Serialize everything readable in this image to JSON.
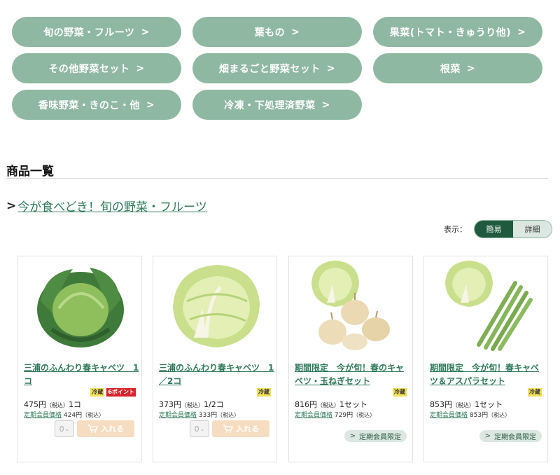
{
  "categories": [
    {
      "label": "旬の野菜・フルーツ"
    },
    {
      "label": "葉もの"
    },
    {
      "label": "果菜(トマト・きゅうり他)"
    },
    {
      "label": "その他野菜セット"
    },
    {
      "label": "畑まるごと野菜セット"
    },
    {
      "label": "根菜"
    },
    {
      "label": "香味野菜・きのこ・他"
    },
    {
      "label": "冷凍・下処理済野菜"
    }
  ],
  "chevron": ">",
  "section_title": "商品一覧",
  "breadcrumb": {
    "arrow": ">",
    "label": "今が食べどき！旬の野菜・フルーツ"
  },
  "view": {
    "label": "表示：",
    "simple": "簡易",
    "detail": "詳細",
    "active": "簡易"
  },
  "tax_label": "（税込）",
  "member_price_label": "定期会員価格",
  "colors": {
    "accent": "#8fb8a3",
    "dark": "#1f5a3e",
    "link": "#2f7a5a",
    "cart": "#f6dcc0",
    "badge_cold": "#f2e05a",
    "badge_point": "#d8232a"
  },
  "products": [
    {
      "name": "三浦のふんわり春キャベツ　1コ",
      "cold": "冷蔵",
      "point": "6ポイント",
      "price": "475円",
      "unit": "1コ",
      "member_price": "424円",
      "qty": "0",
      "cart": "入れる",
      "image": "cabbage-whole"
    },
    {
      "name": "三浦のふんわり春キャベツ　1／2コ",
      "cold": "冷蔵",
      "price": "373円",
      "unit": "1/2コ",
      "member_price": "333円",
      "qty": "0",
      "cart": "入れる",
      "image": "cabbage-half"
    },
    {
      "name": "期間限定　今が旬！春のキャベツ・玉ねぎセット",
      "cold": "冷蔵",
      "price": "816円",
      "unit": "1セット",
      "member_price": "729円",
      "member_only": "定期会員限定",
      "image": "cabbage-onion-set"
    },
    {
      "name": "期間限定　今が旬！春キャベツ＆アスパラセット",
      "cold": "冷蔵",
      "price": "853円",
      "unit": "1セット",
      "member_price": "853円",
      "member_only": "定期会員限定",
      "image": "cabbage-asparagus-set"
    }
  ]
}
